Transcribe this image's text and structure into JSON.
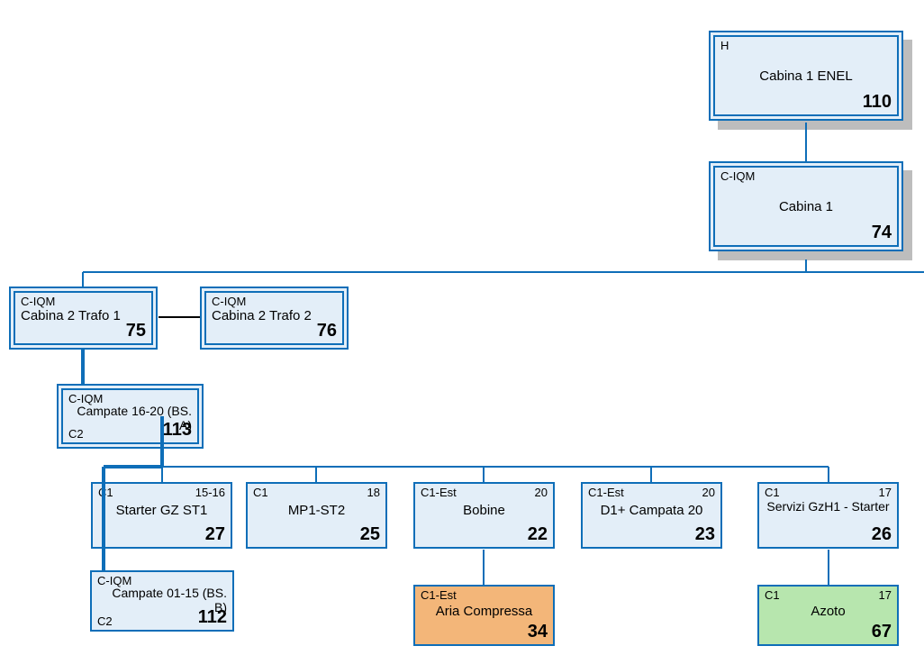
{
  "nodes": {
    "n110": {
      "tag": "H",
      "title": "Cabina 1  ENEL",
      "id": "110"
    },
    "n74": {
      "tag": "C-IQM",
      "title": "Cabina 1",
      "id": "74"
    },
    "n75": {
      "tag": "C-IQM",
      "title": "Cabina 2 Trafo 1",
      "id": "75"
    },
    "n76": {
      "tag": "C-IQM",
      "title": "Cabina 2 Trafo 2",
      "id": "76"
    },
    "n113": {
      "tag": "C-IQM",
      "title": "Campate 16-20 (BS. A)",
      "left_bottom": "C2",
      "id": "113"
    },
    "n27": {
      "tag": "C1",
      "right": "15-16",
      "title": "Starter GZ ST1",
      "id": "27"
    },
    "n25": {
      "tag": "C1",
      "right": "18",
      "title": "MP1-ST2",
      "id": "25"
    },
    "n22": {
      "tag": "C1-Est",
      "right": "20",
      "title": "Bobine",
      "id": "22"
    },
    "n23": {
      "tag": "C1-Est",
      "right": "20",
      "title": "D1+ Campata 20",
      "id": "23"
    },
    "n26": {
      "tag": "C1",
      "right": "17",
      "title": "Servizi GzH1 - Starter",
      "id": "26"
    },
    "n112": {
      "tag": "C-IQM",
      "title": "Campate 01-15 (BS. B)",
      "left_bottom": "C2",
      "id": "112"
    },
    "n34": {
      "tag": "C1-Est",
      "title": "Aria Compressa",
      "id": "34"
    },
    "n67": {
      "tag": "C1",
      "right": "17",
      "title": "Azoto",
      "id": "67"
    }
  },
  "chart_data": {
    "type": "tree",
    "title": "",
    "nodes": [
      {
        "id": 110,
        "label": "Cabina 1  ENEL",
        "tag": "H",
        "style": "double-blue"
      },
      {
        "id": 74,
        "label": "Cabina 1",
        "tag": "C-IQM",
        "style": "double-blue"
      },
      {
        "id": 75,
        "label": "Cabina 2 Trafo 1",
        "tag": "C-IQM",
        "style": "double-blue"
      },
      {
        "id": 76,
        "label": "Cabina 2 Trafo 2",
        "tag": "C-IQM",
        "style": "double-blue"
      },
      {
        "id": 113,
        "label": "Campate 16-20 (BS. A)",
        "tag": "C-IQM",
        "corner": "C2",
        "style": "double-blue"
      },
      {
        "id": 27,
        "label": "Starter GZ ST1",
        "tag": "C1",
        "right": "15-16",
        "style": "single-blue"
      },
      {
        "id": 25,
        "label": "MP1-ST2",
        "tag": "C1",
        "right": "18",
        "style": "single-blue"
      },
      {
        "id": 22,
        "label": "Bobine",
        "tag": "C1-Est",
        "right": "20",
        "style": "single-blue"
      },
      {
        "id": 23,
        "label": "D1+ Campata 20",
        "tag": "C1-Est",
        "right": "20",
        "style": "single-blue"
      },
      {
        "id": 26,
        "label": "Servizi GzH1 - Starter",
        "tag": "C1",
        "right": "17",
        "style": "single-blue"
      },
      {
        "id": 112,
        "label": "Campate 01-15 (BS. B)",
        "tag": "C-IQM",
        "corner": "C2",
        "style": "single-blue"
      },
      {
        "id": 34,
        "label": "Aria Compressa",
        "tag": "C1-Est",
        "style": "single-orange"
      },
      {
        "id": 67,
        "label": "Azoto",
        "tag": "C1",
        "right": "17",
        "style": "single-green"
      }
    ],
    "edges": [
      {
        "from": 110,
        "to": 74
      },
      {
        "from": 74,
        "to": 75
      },
      {
        "from": 75,
        "to": 76,
        "style": "lateral-black"
      },
      {
        "from": 75,
        "to": 113
      },
      {
        "from": 113,
        "to": 27
      },
      {
        "from": 113,
        "to": 25
      },
      {
        "from": 113,
        "to": 22
      },
      {
        "from": 113,
        "to": 23
      },
      {
        "from": 113,
        "to": 26
      },
      {
        "from": 113,
        "to": 112
      },
      {
        "from": 22,
        "to": 34
      },
      {
        "from": 26,
        "to": 67
      }
    ]
  }
}
